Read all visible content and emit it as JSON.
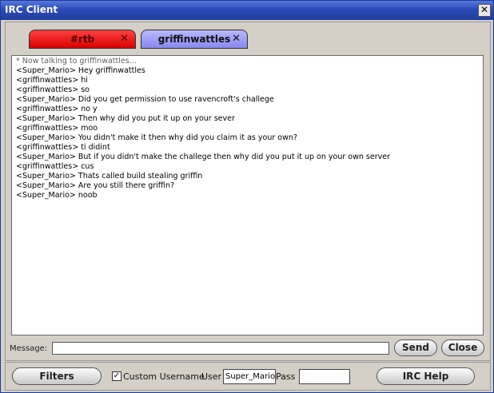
{
  "window": {
    "title": "IRC Client",
    "close_glyph": "✕"
  },
  "tabs": [
    {
      "label": "#rtb",
      "close": "✕",
      "color": "#e00000"
    },
    {
      "label": "griffinwattles",
      "close": "✕",
      "color": "#9999ff"
    }
  ],
  "chat": {
    "lines": [
      "* Now talking to griffinwattles...",
      "<Super_Mario> Hey griffinwattles",
      "<griffinwattles> hi",
      "<griffinwattles> so",
      "<Super_Mario> Did you get permission to use ravencroft's challege",
      "<griffinwattles> no y",
      "<Super_Mario> Then why did you put it up on your sever",
      "<griffinwattles> moo",
      "<Super_Mario> You didn't make it then why did you claim it as your own?",
      "<griffinwattles> ti didint",
      "<Super_Mario> But if you didn't make the challege then why did you put it up on your own server",
      "<griffinwattles> cus",
      "<Super_Mario> Thats called build stealing griffin",
      "<Super_Mario> Are you still there griffin?",
      "<Super_Mario> noob"
    ]
  },
  "message": {
    "label": "Message:",
    "value": ""
  },
  "buttons": {
    "send": "Send",
    "close": "Close",
    "filters": "Filters",
    "irc_help": "IRC Help"
  },
  "options": {
    "custom_username_label": "Custom Username",
    "custom_username_checked": true,
    "check_glyph": "✓",
    "user_label": "User",
    "user_value": "Super_Mario",
    "pass_label": "Pass",
    "pass_value": ""
  }
}
